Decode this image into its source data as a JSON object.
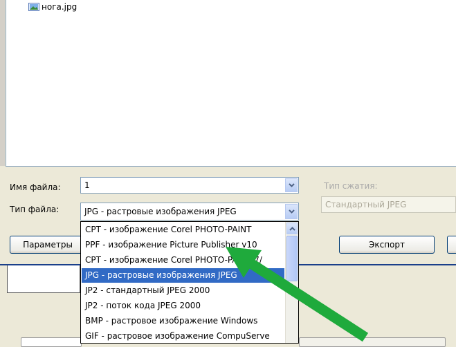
{
  "file_list": {
    "items": [
      {
        "name": "нога.jpg",
        "icon": "image-file-icon"
      }
    ]
  },
  "filename": {
    "label": "Имя файла:",
    "value": "1"
  },
  "filetype": {
    "label": "Тип файла:",
    "value": "JPG - растровые изображения JPEG"
  },
  "compression": {
    "label": "Тип сжатия:",
    "value": "Стандартный JPEG"
  },
  "buttons": {
    "params": "Параметры",
    "export": "Экспорт"
  },
  "dropdown": {
    "items": [
      {
        "text": "CPT - изображение Corel PHOTO-PAINT",
        "selected": false
      },
      {
        "text": "PPF - изображение Picture Publisher v10",
        "selected": false
      },
      {
        "text": "CPT - изображение Corel PHOTO-PAINT 7/",
        "selected": false
      },
      {
        "text": "JPG - растровые изображения JPEG",
        "selected": true
      },
      {
        "text": "JP2 - стандартный JPEG 2000",
        "selected": false
      },
      {
        "text": "JP2 - поток кода JPEG 2000",
        "selected": false
      },
      {
        "text": "BMP - растровое изображение Windows",
        "selected": false
      },
      {
        "text": "GIF - растровое изображение CompuServe",
        "selected": false
      }
    ]
  },
  "colors": {
    "selection": "#316ac5",
    "arrow": "#1faa3c",
    "xp_border": "#7f9db9"
  }
}
